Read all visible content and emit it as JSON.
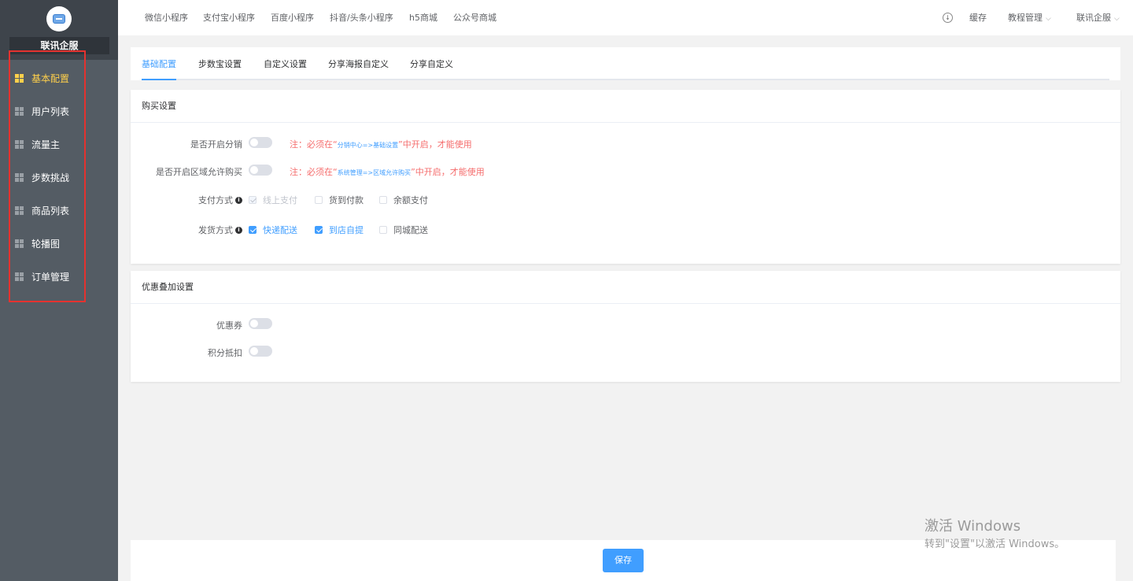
{
  "sidebar": {
    "brand": "联讯企服",
    "items": [
      {
        "label": "基本配置",
        "active": true
      },
      {
        "label": "用户列表",
        "active": false
      },
      {
        "label": "流量主",
        "active": false
      },
      {
        "label": "步数挑战",
        "active": false
      },
      {
        "label": "商品列表",
        "active": false
      },
      {
        "label": "轮播图",
        "active": false
      },
      {
        "label": "订单管理",
        "active": false
      }
    ]
  },
  "topnav": {
    "tabs": [
      "微信小程序",
      "支付宝小程序",
      "百度小程序",
      "抖音/头条小程序",
      "h5商城",
      "公众号商城"
    ],
    "cache": "缓存",
    "tutorial": "教程管理",
    "account": "联讯企服"
  },
  "subtabs": {
    "items": [
      "基础配置",
      "步数宝设置",
      "自定义设置",
      "分享海报自定义",
      "分享自定义"
    ],
    "active": 0
  },
  "purchase": {
    "title": "购买设置",
    "distribution": {
      "label": "是否开启分销",
      "enabled": false,
      "note_prefix": "注：必须在“",
      "note_path": "分销中心=>基础设置",
      "note_suffix": "”中开启，才能使用"
    },
    "region": {
      "label": "是否开启区域允许购买",
      "enabled": false,
      "note_prefix": "注：必须在“",
      "note_path": "系统管理=>区域允许购买",
      "note_suffix": "”中开启，才能使用"
    },
    "payment": {
      "label": "支付方式",
      "options": [
        {
          "label": "线上支付",
          "checked": true,
          "disabled": true
        },
        {
          "label": "货到付款",
          "checked": false,
          "disabled": false
        },
        {
          "label": "余额支付",
          "checked": false,
          "disabled": false
        }
      ]
    },
    "delivery": {
      "label": "发货方式",
      "options": [
        {
          "label": "快递配送",
          "checked": true
        },
        {
          "label": "到店自提",
          "checked": true
        },
        {
          "label": "同城配送",
          "checked": false
        }
      ]
    }
  },
  "discount": {
    "title": "优惠叠加设置",
    "coupon": {
      "label": "优惠券",
      "enabled": false
    },
    "points": {
      "label": "积分抵扣",
      "enabled": false
    }
  },
  "save_label": "保存",
  "watermark": {
    "line1": "激活 Windows",
    "line2": "转到\"设置\"以激活 Windows。"
  },
  "colors": {
    "sidebar_bg": "#545c64",
    "active_menu": "#ffd04b",
    "primary": "#409eff",
    "note_red": "#f56c6c",
    "highlight_frame": "#e5322f"
  }
}
